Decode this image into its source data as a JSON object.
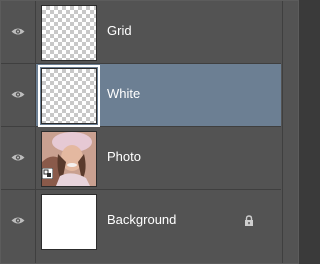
{
  "layers_panel": {
    "layers": [
      {
        "name": "Grid",
        "thumbnail": "transparent-checkerboard",
        "selected": false,
        "visible_icon": "eye-icon"
      },
      {
        "name": "White",
        "thumbnail": "transparent-checkerboard",
        "selected": true,
        "visible_icon": "eye-icon"
      },
      {
        "name": "Photo",
        "thumbnail": "photo-of-woman",
        "selected": false,
        "visible_icon": "eye-icon",
        "badge_icon": "smart-object-icon"
      },
      {
        "name": "Background",
        "thumbnail": "white-fill",
        "selected": false,
        "visible_icon": "eye-icon",
        "lock_icon": "lock-icon"
      }
    ],
    "colors": {
      "panel_bg": "#535353",
      "selected_bg": "#6c7f93",
      "text": "#ffffff"
    }
  }
}
